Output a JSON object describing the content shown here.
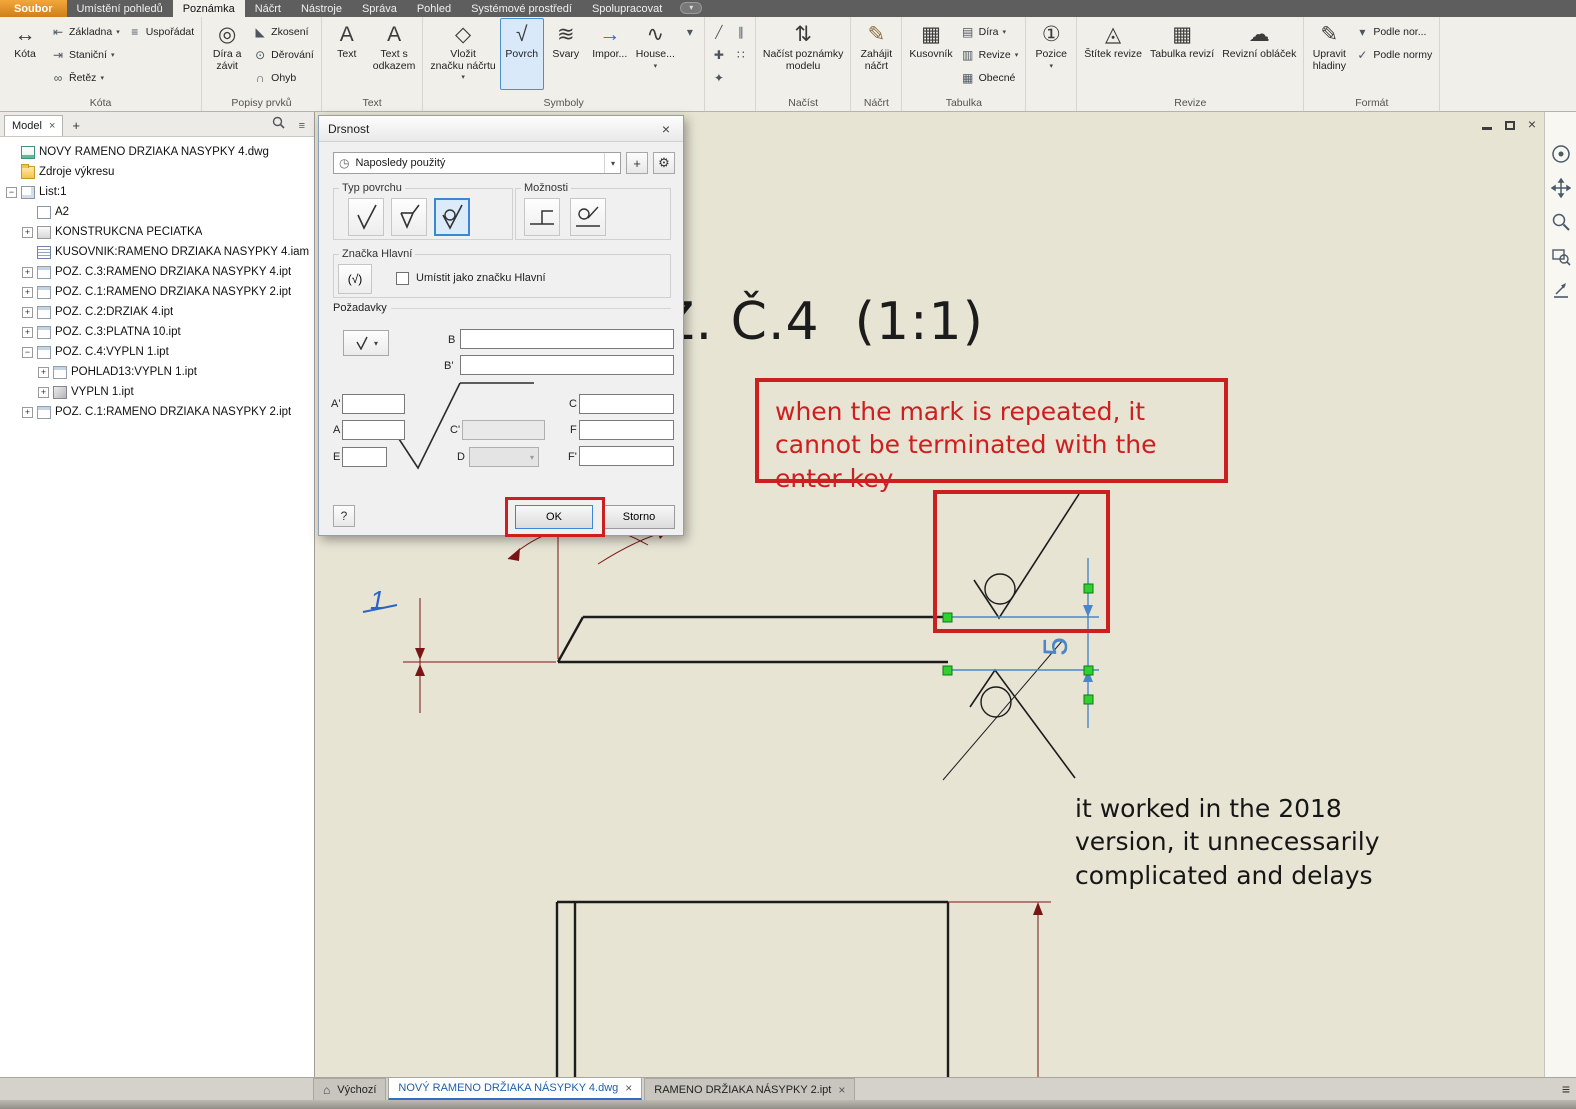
{
  "colors": {
    "accent_red": "#cc2020",
    "canvas_bg": "#e7e4d4",
    "selection_blue": "#4a90d9",
    "grip_green": "#2fd02f",
    "dimension_maroon": "#7a1515",
    "dimension_blue": "#4a86c8"
  },
  "ribbon_tabs": [
    {
      "label": "Soubor",
      "file": true
    },
    {
      "label": "Umístění pohledů"
    },
    {
      "label": "Poznámka",
      "active": true
    },
    {
      "label": "Náčrt"
    },
    {
      "label": "Nástroje"
    },
    {
      "label": "Správa"
    },
    {
      "label": "Pohled"
    },
    {
      "label": "Systémové prostředí"
    },
    {
      "label": "Spolupracovat"
    }
  ],
  "ribbon_groups": [
    {
      "label": "Kóta",
      "cols": [
        {
          "big": {
            "label": "Kóta",
            "icon": "↔",
            "icon_name": "dimension-icon"
          }
        },
        {
          "stack": [
            {
              "label": "Základna",
              "icon": "⇤",
              "icon_name": "baseline-dimension-icon",
              "arrow": true
            },
            {
              "label": "Staniční",
              "icon": "⇥",
              "icon_name": "ordinate-dimension-icon",
              "arrow": true
            },
            {
              "label": "Řetěz",
              "icon": "∞",
              "icon_name": "chain-dimension-icon",
              "arrow": true
            }
          ]
        },
        {
          "stack": [
            {
              "label": "Uspořádat",
              "icon": "≡",
              "icon_name": "arrange-dimensions-icon"
            }
          ]
        }
      ]
    },
    {
      "label": "Popisy prvků",
      "cols": [
        {
          "big": {
            "label": "Díra a\nzávit",
            "icon": "◎",
            "icon_name": "hole-thread-note-icon"
          }
        },
        {
          "stack": [
            {
              "label": "Zkosení",
              "icon": "◣",
              "icon_name": "chamfer-note-icon"
            },
            {
              "label": "Děrování",
              "icon": "⊙",
              "icon_name": "punch-note-icon"
            },
            {
              "label": "Ohyb",
              "icon": "∩",
              "icon_name": "bend-note-icon"
            }
          ]
        }
      ]
    },
    {
      "label": "Text",
      "cols": [
        {
          "big": {
            "label": "Text",
            "icon": "A",
            "icon_name": "text-icon"
          }
        },
        {
          "big": {
            "label": "Text s\nodkazem",
            "icon": "A",
            "icon_name": "leader-text-icon"
          }
        }
      ]
    },
    {
      "label": "Symboly",
      "cols": [
        {
          "big": {
            "label": "Vložit\nznačku náčrtu",
            "icon": "◇",
            "icon_name": "insert-sketch-symbol-icon",
            "arrow": true
          }
        },
        {
          "big": {
            "label": "Povrch",
            "icon": "√",
            "icon_name": "surface-texture-icon",
            "selected": true
          }
        },
        {
          "big": {
            "label": "Svary",
            "icon": "≋",
            "icon_name": "weld-symbol-icon"
          }
        },
        {
          "big": {
            "label": "Impor...",
            "icon": "→",
            "icon_name": "import-symbol-icon",
            "icon_color": "#1c6fd4"
          }
        },
        {
          "big": {
            "label": "House...",
            "icon": "∿",
            "icon_name": "caterpillar-symbol-icon",
            "arrow": true
          }
        },
        {
          "stack": [
            {
              "label": "",
              "name": "more-symbols",
              "icon": "▾",
              "icon_name": "more-symbols-icon"
            }
          ]
        }
      ]
    },
    {
      "label": "",
      "cols": [
        {
          "stack": [
            {
              "label": "",
              "name": "sketch-line",
              "icon": "╱",
              "icon_name": "sketch-line-icon"
            },
            {
              "label": "",
              "name": "sketch-point",
              "icon": "✚",
              "icon_name": "sketch-point-icon"
            },
            {
              "label": "",
              "name": "format-painter",
              "icon": "✦",
              "icon_name": "format-painter-icon"
            }
          ]
        },
        {
          "stack": [
            {
              "label": "",
              "name": "sketch-parallel",
              "icon": "∥",
              "icon_name": "sketch-parallel-icon"
            },
            {
              "label": "",
              "name": "sketch-points",
              "icon": "∷",
              "icon_name": "sketch-points-icon"
            }
          ]
        }
      ]
    },
    {
      "label": "Načíst",
      "cols": [
        {
          "big": {
            "label": "Načíst poznámky\nmodelu",
            "icon": "⇅",
            "icon_name": "retrieve-model-annotations-icon"
          }
        }
      ]
    },
    {
      "label": "Náčrt",
      "cols": [
        {
          "big": {
            "label": "Zahájit\nnáčrt",
            "icon": "✎",
            "icon_name": "start-sketch-icon",
            "icon_color": "#8a6d3b"
          }
        }
      ]
    },
    {
      "label": "Tabulka",
      "cols": [
        {
          "big": {
            "label": "Kusovník",
            "icon": "▦",
            "icon_name": "parts-list-icon"
          }
        },
        {
          "stack": [
            {
              "label": "Díra",
              "icon": "▤",
              "icon_name": "hole-table-icon",
              "arrow": true
            },
            {
              "label": "Revize",
              "icon": "▥",
              "icon_name": "revision-table-small-icon",
              "arrow": true
            },
            {
              "label": "Obecné",
              "icon": "▦",
              "icon_name": "general-table-icon"
            }
          ]
        }
      ]
    },
    {
      "label": "",
      "cols": [
        {
          "big": {
            "label": "Pozice",
            "icon": "①",
            "icon_name": "balloon-icon",
            "arrow": true
          }
        }
      ]
    },
    {
      "label": "Revize",
      "cols": [
        {
          "big": {
            "label": "Štítek revize",
            "icon": "◬",
            "icon_name": "revision-tag-icon"
          }
        },
        {
          "big": {
            "label": "Tabulka revizí",
            "icon": "▦",
            "icon_name": "revision-table-icon"
          }
        },
        {
          "big": {
            "label": "Revizní obláček",
            "icon": "☁",
            "icon_name": "revision-cloud-icon"
          }
        }
      ]
    },
    {
      "label": "Formát",
      "cols": [
        {
          "big": {
            "label": "Upravit\nhladiny",
            "icon": "✎",
            "icon_name": "edit-layers-icon"
          }
        },
        {
          "stack": [
            {
              "label": "Podle nor...",
              "icon": "▾",
              "icon_name": "by-standard-dropdown-icon"
            },
            {
              "label": "Podle normy",
              "icon": "✓",
              "icon_name": "by-standard-check-icon"
            }
          ]
        }
      ]
    }
  ],
  "browser": {
    "panel_tab": "Model",
    "panel_tab_close": "×",
    "add_tab": "+",
    "tree": [
      {
        "indent": 0,
        "icon": "dwg",
        "label": "NOVÝ RAMENO DRŽIAKA NÁSYPKY 4.dwg",
        "exp": ""
      },
      {
        "indent": 0,
        "icon": "folder",
        "label": "Zdroje výkresu",
        "exp": ""
      },
      {
        "indent": 0,
        "icon": "sheet",
        "label": "List:1",
        "exp": "-"
      },
      {
        "indent": 1,
        "icon": "a2",
        "label": "A2",
        "exp": ""
      },
      {
        "indent": 1,
        "icon": "stamp",
        "label": "KONŠTRUKČNÁ PEČIATKA",
        "exp": "+"
      },
      {
        "indent": 1,
        "icon": "bom",
        "label": "KUSOVNÍK:RAMENO DRŽIAKA NÁSYPKY 4.iam",
        "exp": ""
      },
      {
        "indent": 1,
        "icon": "view",
        "label": "POZ. Č.3:RAMENO DRŽIAKA NÁSYPKY 4.ipt",
        "exp": "+"
      },
      {
        "indent": 1,
        "icon": "view",
        "label": "POZ. Č.1:RAMENO DRŽIAKA NÁSYPKY 2.ipt",
        "exp": "+"
      },
      {
        "indent": 1,
        "icon": "view",
        "label": "POZ. Č.2:DRŽIAK 4.ipt",
        "exp": "+"
      },
      {
        "indent": 1,
        "icon": "view",
        "label": "POZ. Č.3:PLATŇA 10.ipt",
        "exp": "+"
      },
      {
        "indent": 1,
        "icon": "view",
        "label": "POZ. Č.4:VÝPLŇ 1.ipt",
        "exp": "-"
      },
      {
        "indent": 2,
        "icon": "view",
        "label": "POHLAD13:VÝPLŇ 1.ipt",
        "exp": "+"
      },
      {
        "indent": 2,
        "icon": "part",
        "label": "VÝPLŇ 1.ipt",
        "exp": "+"
      },
      {
        "indent": 1,
        "icon": "view",
        "label": "POZ. Č.1:RAMENO DRŽIAKA NÁSYPKY 2.ipt",
        "exp": "+"
      }
    ]
  },
  "dialog": {
    "title": "Drsnost",
    "style_value": "Naposledy použitý",
    "new_style": "+",
    "group_surface": "Typ povrchu",
    "group_options": "Možnosti",
    "group_mark": "Značka Hlavní",
    "group_requirements": "Požadavky",
    "checkbox_label": "Umístit jako značku Hlavní",
    "fields": {
      "b": "B",
      "b2": "B'",
      "a2": "A'",
      "a": "A",
      "c2": "C'",
      "c": "C",
      "e": "E",
      "d": "D",
      "f": "F",
      "f2": "F'"
    },
    "ok_label": "OK",
    "cancel_label": "Storno",
    "help_label": "?"
  },
  "canvas": {
    "view_label": "Z. Č.4  (1:1)",
    "note_repeat": "when the mark is repeated, it cannot be terminated with the enter key",
    "note_2018": "it worked in the 2018 version, it unnecessarily complicated and delays",
    "dim_5": "5",
    "dim_1": "1"
  },
  "doc_tabs": [
    {
      "label": "Výchozí",
      "home": true
    },
    {
      "label": "NOVÝ RAMENO DRŽIAKA NÁSYPKY 4.dwg",
      "close": "×",
      "active": true
    },
    {
      "label": "RAMENO DRŽIAKA NÁSYPKY 2.ipt",
      "close": "×"
    }
  ]
}
